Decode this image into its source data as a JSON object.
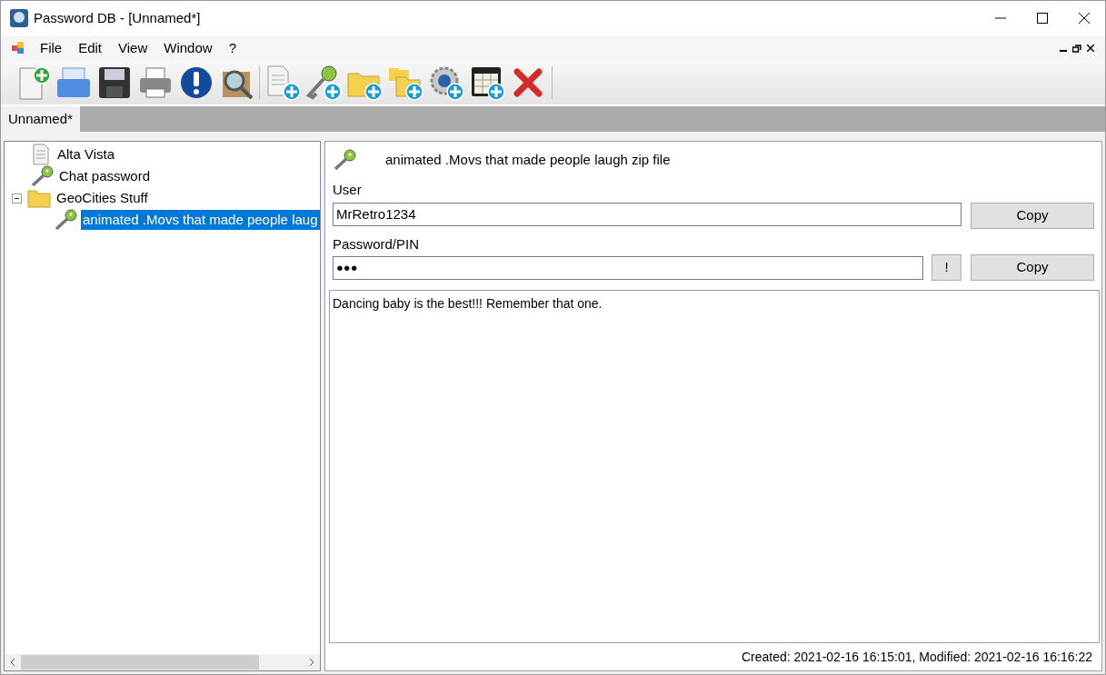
{
  "window": {
    "title": "Password DB - [Unnamed*]"
  },
  "menu": [
    "File",
    "Edit",
    "View",
    "Window",
    "?"
  ],
  "tabs": [
    {
      "label": "Unnamed*",
      "selected": true
    }
  ],
  "tree": [
    {
      "kind": "note",
      "label": "Alta Vista",
      "selected": false
    },
    {
      "kind": "key",
      "label": "Chat password",
      "selected": false
    },
    {
      "kind": "folder",
      "label": "GeoCities Stuff",
      "selected": false,
      "expanded": true,
      "children": [
        {
          "kind": "key",
          "label": "animated .Movs that made people laug",
          "selected": true
        }
      ]
    }
  ],
  "entry": {
    "title": "animated .Movs that made people laugh zip file",
    "user_label": "User",
    "user": "MrRetro1234",
    "password_label": "Password/PIN",
    "password": "●●●",
    "reveal_button": "!",
    "copy_buttons": [
      "Copy",
      "Copy"
    ],
    "notes": "Dancing baby is the best!!! Remember that one."
  },
  "status_bar": "Created: 2021-02-16 16:15:01, Modified: 2021-02-16 16:16:22"
}
